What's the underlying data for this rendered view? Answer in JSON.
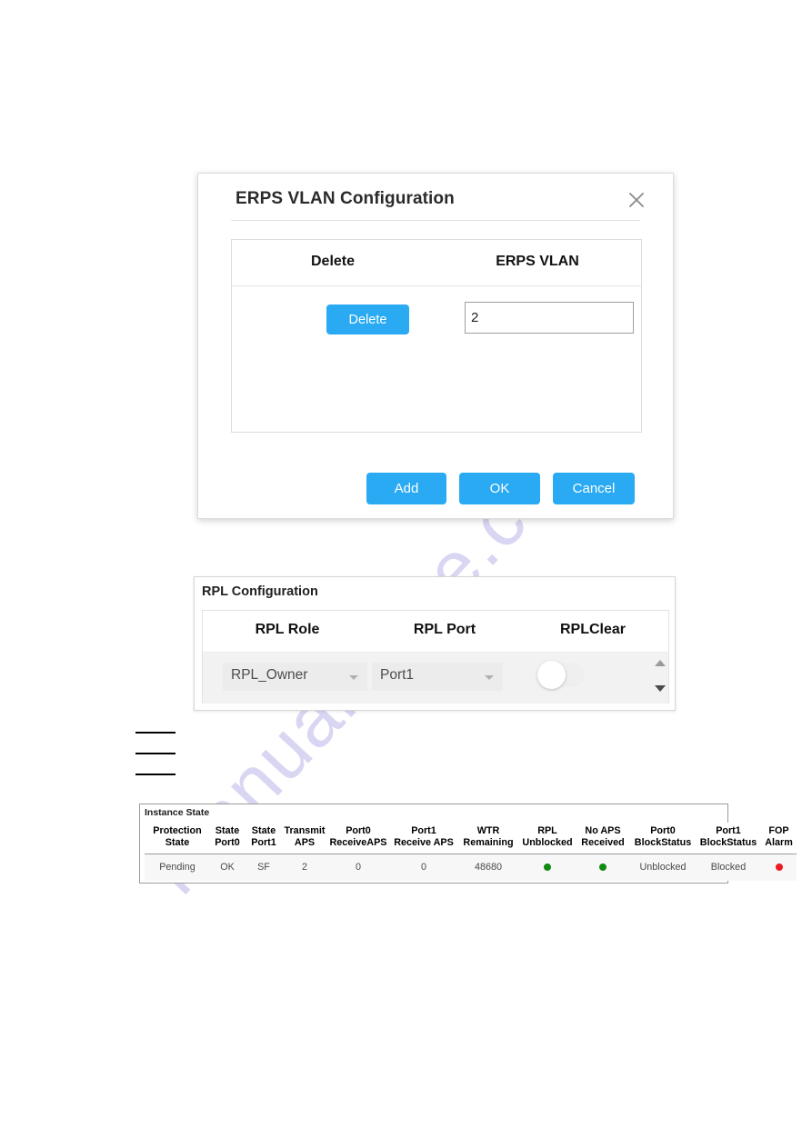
{
  "watermark": {
    "text": "manualshive.com"
  },
  "erps_dialog": {
    "title": "ERPS VLAN Configuration",
    "close_icon": "close-icon",
    "table": {
      "headers": [
        "Delete",
        "ERPS VLAN"
      ],
      "row": {
        "delete_label": "Delete",
        "vlan_value": "2"
      }
    },
    "buttons": {
      "add": "Add",
      "ok": "OK",
      "cancel": "Cancel"
    },
    "accent_color": "#29aaf2"
  },
  "rpl_panel": {
    "title": "RPL Configuration",
    "headers": [
      "RPL Role",
      "RPL Port",
      "RPLClear"
    ],
    "row": {
      "rpl_role": "RPL_Owner",
      "rpl_port": "Port1",
      "rpl_clear": "off"
    },
    "scrollbar": {
      "up_icon": "caret-up-icon",
      "down_icon": "caret-down-icon"
    }
  },
  "instance_state": {
    "title": "Instance State",
    "headers": [
      "Protection\nState",
      "State\nPort0",
      "State\nPort1",
      "Transmit\nAPS",
      "Port0\nReceiveAPS",
      "Port1\nReceive APS",
      "WTR\nRemaining",
      "RPL\nUnblocked",
      "No APS\nReceived",
      "Port0\nBlockStatus",
      "Port1\nBlockStatus",
      "FOP\nAlarm"
    ],
    "row": {
      "protection_state": "Pending",
      "state_port0": "OK",
      "state_port1": "SF",
      "transmit_aps": "2",
      "port0_receive_aps": "0",
      "port1_receive_aps": "0",
      "wtr_remaining": "48680",
      "rpl_unblocked": "green",
      "no_aps_received": "green",
      "port0_blockstatus": "Unblocked",
      "port1_blockstatus": "Blocked",
      "fop_alarm": "red"
    },
    "colors": {
      "green": "#0f8a12",
      "red": "#ee1b22"
    }
  }
}
